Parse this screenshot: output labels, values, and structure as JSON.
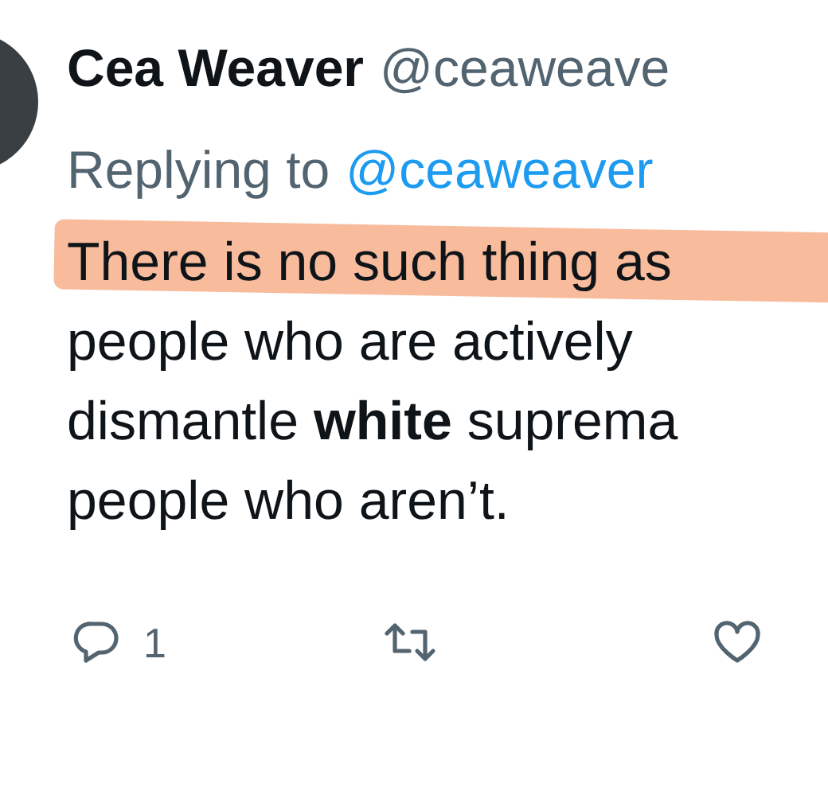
{
  "tweet": {
    "author": "Cea Weaver",
    "handle": "@ceaweave",
    "replying_prefix": "Replying to",
    "replying_handle": "@ceaweaver",
    "highlighted": true,
    "lines": [
      "There is no such thing as",
      "people who are actively",
      "dismantle **white** suprema",
      "people who aren’t."
    ],
    "actions": [
      {
        "kind": "reply",
        "count": "1"
      },
      {
        "kind": "retweet"
      },
      {
        "kind": "like"
      }
    ]
  }
}
